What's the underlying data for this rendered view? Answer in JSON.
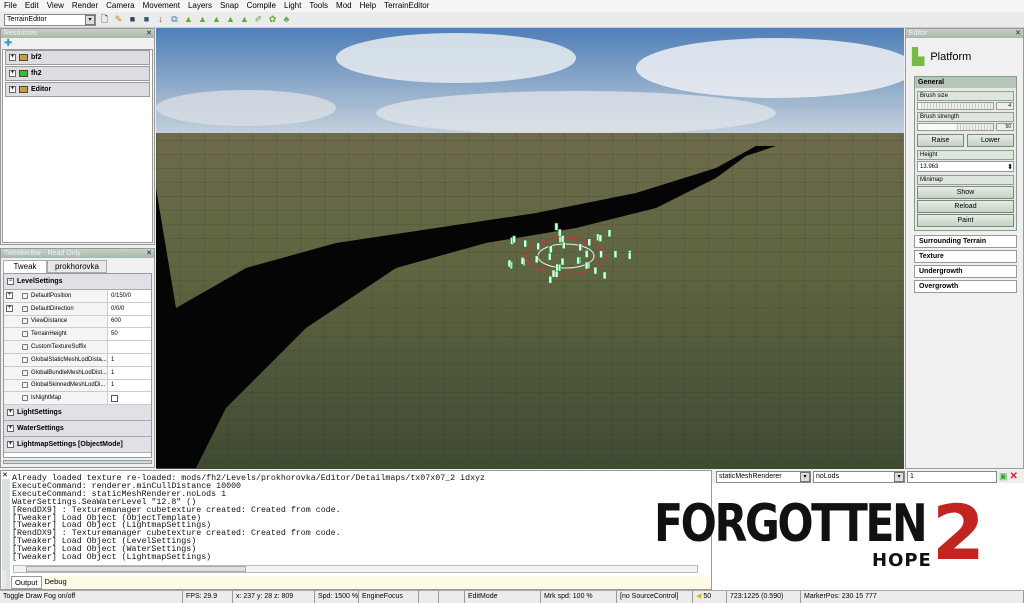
{
  "menu": [
    "File",
    "Edit",
    "View",
    "Render",
    "Camera",
    "Movement",
    "Layers",
    "Snap",
    "Compile",
    "Light",
    "Tools",
    "Mod",
    "Help",
    "TerrainEditor"
  ],
  "toolbar": {
    "editor_select": "TerrainEditor"
  },
  "resources": {
    "title": "Resources",
    "items": [
      {
        "label": "bf2",
        "icon": "folder-icon",
        "color": "#c8a040"
      },
      {
        "label": "fh2",
        "icon": "folder-green-icon",
        "color": "#30c030"
      },
      {
        "label": "Editor",
        "icon": "folder-icon",
        "color": "#c8a040"
      }
    ]
  },
  "tweaker": {
    "title": "TweakerBar - Read Only",
    "tabs": [
      "Tweak",
      "prokhorovka"
    ],
    "group": "LevelSettings",
    "rows": [
      {
        "name": "DefaultPosition",
        "value": "0/150/0",
        "expandable": true
      },
      {
        "name": "DefaultDirection",
        "value": "0/0/0",
        "expandable": true
      },
      {
        "name": "ViewDistance",
        "value": "600"
      },
      {
        "name": "TerrainHeight",
        "value": "50"
      },
      {
        "name": "CustomTextureSuffix",
        "value": ""
      },
      {
        "name": "GlobalStaticMeshLodDista...",
        "value": "1"
      },
      {
        "name": "GlobalBundleMeshLodDist...",
        "value": "1"
      },
      {
        "name": "GlobalSkinnedMeshLodDi...",
        "value": "1"
      },
      {
        "name": "IsNightMap",
        "value": "",
        "checkbox": false
      }
    ],
    "groups": [
      "LightSettings",
      "WaterSettings",
      "LightmapSettings [ObjectMode]"
    ]
  },
  "editor": {
    "title": "Editor",
    "tool": "Platform",
    "general": "General",
    "brush_size_label": "Brush size",
    "brush_size": "4",
    "brush_size_fraction": 0.04,
    "brush_strength_label": "Brush strength",
    "brush_strength": "50",
    "brush_strength_fraction": 0.5,
    "raise": "Raise",
    "lower": "Lower",
    "height_label": "Height",
    "height": "13.963",
    "minimap_label": "Minimap",
    "show": "Show",
    "reload": "Reload",
    "paint": "Paint",
    "sections": [
      "Surrounding Terrain",
      "Texture",
      "Undergrowth",
      "Overgrowth"
    ]
  },
  "console": {
    "side_label": "Output",
    "lines": [
      "Already loaded texture re-loaded: mods/fh2/Levels/prokhorovka/Editor/Detailmaps/tx07x07_2 idxyz",
      "ExecuteCommand: renderer.minCullDistance 10000",
      "ExecuteCommand: staticMeshRenderer.noLods 1",
      "WaterSettings.SeaWaterLevel \"12.8\" ()",
      "[RendDX9] : Texturemanager cubetexture created: Created from code.",
      "[Tweaker] Load Object (ObjectTemplate)",
      "[Tweaker] Load Object (LightmapSettings)",
      "[RendDX9] : Texturemanager cubetexture created: Created from code.",
      "[Tweaker] Load Object (LevelSettings)",
      "[Tweaker] Load Object (WaterSettings)",
      "[Tweaker] Load Object (LightmapSettings)"
    ],
    "tabs": [
      "Output",
      "Debug"
    ]
  },
  "command": {
    "object": "staticMeshRenderer",
    "property": "noLods",
    "value": "1"
  },
  "logo": {
    "text": "FORGOTTEN",
    "number": "2",
    "sub": "HOPE"
  },
  "status": [
    "Toggle Draw Fog on/off",
    "FPS: 29.9",
    "x: 237 y: 28 z: 809",
    "Spd: 1500 %",
    "EngineFocus",
    "",
    "",
    "EditMode",
    "Mrk spd: 100 %",
    "[no SourceControl]",
    "50",
    "723:1225 (0.590)",
    "MarkerPos: 230 15 777"
  ]
}
